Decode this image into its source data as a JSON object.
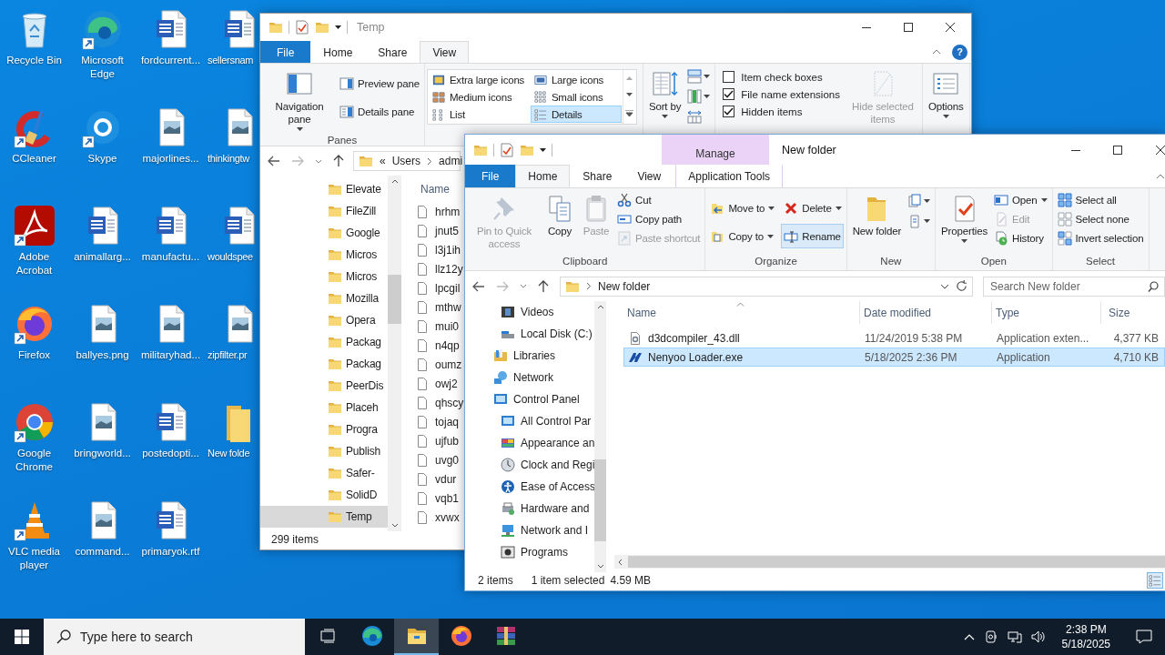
{
  "desktop": {
    "icons": [
      {
        "label": "Recycle Bin",
        "kind": "recycle-bin",
        "shortcut": false
      },
      {
        "label": "CCleaner",
        "kind": "ccleaner",
        "shortcut": true
      },
      {
        "label": "Adobe Acrobat",
        "kind": "acrobat",
        "shortcut": true
      },
      {
        "label": "Firefox",
        "kind": "firefox",
        "shortcut": true
      },
      {
        "label": "Google Chrome",
        "kind": "chrome",
        "shortcut": true
      },
      {
        "label": "VLC media player",
        "kind": "vlc",
        "shortcut": true
      },
      {
        "label": "Microsoft Edge",
        "kind": "edge",
        "shortcut": true
      },
      {
        "label": "Skype",
        "kind": "skype",
        "shortcut": true
      },
      {
        "label": "animallarg...",
        "kind": "word",
        "shortcut": false
      },
      {
        "label": "ballyes.png",
        "kind": "image",
        "shortcut": false
      },
      {
        "label": "bringworld...",
        "kind": "image",
        "shortcut": false
      },
      {
        "label": "command...",
        "kind": "image",
        "shortcut": false
      },
      {
        "label": "fordcurrent...",
        "kind": "word",
        "shortcut": false
      },
      {
        "label": "majorlines...",
        "kind": "image",
        "shortcut": false
      },
      {
        "label": "manufactu...",
        "kind": "word",
        "shortcut": false
      },
      {
        "label": "militaryhad...",
        "kind": "image",
        "shortcut": false
      },
      {
        "label": "postedopti...",
        "kind": "word",
        "shortcut": false
      },
      {
        "label": "primaryok.rtf",
        "kind": "word",
        "shortcut": false
      },
      {
        "label": "sellersnam",
        "kind": "word",
        "shortcut": false
      },
      {
        "label": "thinkingtw",
        "kind": "image",
        "shortcut": false
      },
      {
        "label": "wouldspee",
        "kind": "word",
        "shortcut": false
      },
      {
        "label": "zipfilter.pr",
        "kind": "image",
        "shortcut": false
      },
      {
        "label": "New folde",
        "kind": "folder",
        "shortcut": false
      }
    ]
  },
  "temp_window": {
    "title": "Temp",
    "tabs": [
      {
        "label": "File",
        "kind": "file",
        "selected": false
      },
      {
        "label": "Home",
        "kind": "tab",
        "selected": false
      },
      {
        "label": "Share",
        "kind": "tab",
        "selected": false
      },
      {
        "label": "View",
        "kind": "tab",
        "selected": true
      }
    ],
    "help": "?",
    "ribbon": [
      {
        "kind": "commands",
        "label": "Panes",
        "commands": [
          {
            "label": "Navigation pane",
            "kind": "large",
            "dropdown": true,
            "disabled": false,
            "highlighted": false
          },
          {
            "label": "Preview pane",
            "kind": "medium",
            "dropdown": false,
            "disabled": false,
            "highlighted": false
          },
          {
            "label": "Details pane",
            "kind": "medium",
            "dropdown": false,
            "disabled": false,
            "highlighted": false
          }
        ]
      },
      {
        "kind": "gallery",
        "items": [
          {
            "label": "Extra large icons",
            "selected": false
          },
          {
            "label": "Large icons",
            "selected": false
          },
          {
            "label": "Medium icons",
            "selected": false
          },
          {
            "label": "Small icons",
            "selected": false
          },
          {
            "label": "List",
            "selected": false
          },
          {
            "label": "Details",
            "selected": true
          }
        ]
      },
      {
        "kind": "commands",
        "commands": [
          {
            "label": "Sort by",
            "kind": "large",
            "dropdown": true,
            "disabled": false,
            "highlighted": false
          },
          {
            "kind": "icon",
            "dropdown": true,
            "disabled": false,
            "highlighted": false
          },
          {
            "kind": "icon",
            "dropdown": true,
            "disabled": false,
            "highlighted": false
          },
          {
            "kind": "icon",
            "dropdown": false,
            "disabled": false,
            "highlighted": false
          }
        ]
      },
      {
        "kind": "checks",
        "checks": [
          {
            "label": "Item check boxes",
            "checked": false
          },
          {
            "label": "File name extensions",
            "checked": true
          },
          {
            "label": "Hidden items",
            "checked": true
          }
        ],
        "commands": [
          {
            "label": "Hide selected items",
            "kind": "large",
            "dropdown": false,
            "disabled": true,
            "highlighted": false
          }
        ]
      },
      {
        "kind": "commands",
        "commands": [
          {
            "label": "Options",
            "kind": "large",
            "dropdown": true,
            "disabled": false,
            "highlighted": false
          }
        ]
      }
    ],
    "address": {
      "overflow": "«",
      "path": [
        "Users",
        "admi"
      ]
    },
    "nav": [
      {
        "label": "Elevate",
        "selected": false
      },
      {
        "label": "FileZill",
        "selected": false
      },
      {
        "label": "Google",
        "selected": false
      },
      {
        "label": "Micros",
        "selected": false
      },
      {
        "label": "Micros",
        "selected": false
      },
      {
        "label": "Mozilla",
        "selected": false
      },
      {
        "label": "Opera",
        "selected": false
      },
      {
        "label": "Packag",
        "selected": false
      },
      {
        "label": "Packag",
        "selected": false
      },
      {
        "label": "PeerDis",
        "selected": false
      },
      {
        "label": "Placeh",
        "selected": false
      },
      {
        "label": "Progra",
        "selected": false
      },
      {
        "label": "Publish",
        "selected": false
      },
      {
        "label": "Safer-",
        "selected": false
      },
      {
        "label": "SolidD",
        "selected": false
      },
      {
        "label": "Temp",
        "selected": true
      }
    ],
    "list_header": "Name",
    "files": [
      "hrhm",
      "jnut5",
      "l3j1ih",
      "llz12y",
      "lpcgil",
      "mthw",
      "mui0",
      "n4qp",
      "oumz",
      "owj2",
      "qhscy",
      "tojaq",
      "ujfub",
      "uvg0",
      "vdur",
      "vqb1",
      "xvwx"
    ],
    "status": "299 items"
  },
  "folder_window": {
    "title": "New folder",
    "context": {
      "header": "Manage",
      "label": "Application Tools",
      "selected": false
    },
    "tabs": [
      {
        "label": "File",
        "kind": "file",
        "selected": false
      },
      {
        "label": "Home",
        "kind": "tab",
        "selected": true
      },
      {
        "label": "Share",
        "kind": "tab",
        "selected": false
      },
      {
        "label": "View",
        "kind": "tab",
        "selected": false
      }
    ],
    "ribbon": [
      {
        "kind": "commands",
        "label": "Clipboard",
        "commands": [
          {
            "label": "Pin to Quick access",
            "kind": "large",
            "dropdown": false,
            "disabled": true,
            "highlighted": false
          },
          {
            "label": "Copy",
            "kind": "large",
            "dropdown": false,
            "disabled": false,
            "highlighted": false
          },
          {
            "label": "Paste",
            "kind": "large",
            "dropdown": false,
            "disabled": true,
            "highlighted": false
          },
          {
            "label": "Cut",
            "kind": "small",
            "dropdown": false,
            "disabled": false,
            "highlighted": false
          },
          {
            "label": "Copy path",
            "kind": "small",
            "dropdown": false,
            "disabled": false,
            "highlighted": false
          },
          {
            "label": "Paste shortcut",
            "kind": "small",
            "dropdown": false,
            "disabled": true,
            "highlighted": false
          }
        ]
      },
      {
        "kind": "commands",
        "label": "Organize",
        "commands": [
          {
            "label": "Move to",
            "kind": "medium",
            "dropdown": true,
            "disabled": false,
            "highlighted": false
          },
          {
            "label": "Copy to",
            "kind": "medium",
            "dropdown": true,
            "disabled": false,
            "highlighted": false
          },
          {
            "label": "Delete",
            "kind": "medium",
            "dropdown": true,
            "disabled": false,
            "highlighted": false
          },
          {
            "label": "Rename",
            "kind": "medium",
            "dropdown": false,
            "disabled": false,
            "highlighted": true
          }
        ]
      },
      {
        "kind": "commands",
        "label": "New",
        "commands": [
          {
            "label": "New folder",
            "kind": "large",
            "dropdown": false,
            "disabled": false,
            "highlighted": false
          },
          {
            "kind": "icon",
            "dropdown": true,
            "disabled": false,
            "highlighted": false
          },
          {
            "kind": "icon",
            "dropdown": true,
            "disabled": false,
            "highlighted": false
          }
        ]
      },
      {
        "kind": "commands",
        "label": "Open",
        "commands": [
          {
            "label": "Properties",
            "kind": "large",
            "dropdown": true,
            "disabled": false,
            "highlighted": false
          },
          {
            "label": "Open",
            "kind": "small",
            "dropdown": true,
            "disabled": false,
            "highlighted": false
          },
          {
            "label": "Edit",
            "kind": "small",
            "dropdown": false,
            "disabled": true,
            "highlighted": false
          },
          {
            "label": "History",
            "kind": "small",
            "dropdown": false,
            "disabled": false,
            "highlighted": false
          }
        ]
      },
      {
        "kind": "commands",
        "label": "Select",
        "commands": [
          {
            "label": "Select all",
            "kind": "small",
            "dropdown": false,
            "disabled": false,
            "highlighted": false
          },
          {
            "label": "Select none",
            "kind": "small",
            "dropdown": false,
            "disabled": false,
            "highlighted": false
          },
          {
            "label": "Invert selection",
            "kind": "small",
            "dropdown": false,
            "disabled": false,
            "highlighted": false
          }
        ]
      }
    ],
    "address": "New folder",
    "search": {
      "placeholder": "Search New folder"
    },
    "nav": {
      "continued": [
        {
          "label": "Videos",
          "kind": "videos"
        },
        {
          "label": "Local Disk (C:)",
          "kind": "disk"
        }
      ],
      "items": [
        {
          "label": "Libraries",
          "kind": "libraries"
        },
        {
          "label": "Network",
          "kind": "network"
        },
        {
          "label": "Control Panel",
          "kind": "control-panel",
          "children": [
            {
              "label": "All Control Par",
              "kind": "control-panel"
            },
            {
              "label": "Appearance an",
              "kind": "appearance"
            },
            {
              "label": "Clock and Regi",
              "kind": "clock"
            },
            {
              "label": "Ease of Access",
              "kind": "ease"
            },
            {
              "label": "Hardware and",
              "kind": "hardware"
            },
            {
              "label": "Network and I",
              "kind": "network-center"
            },
            {
              "label": "Programs",
              "kind": "programs"
            }
          ]
        }
      ]
    },
    "columns": [
      "Name",
      "Date modified",
      "Type",
      "Size"
    ],
    "rows": [
      {
        "name": "d3dcompiler_43.dll",
        "date": "11/24/2019 5:38 PM",
        "type": "Application exten...",
        "size": "4,377 KB",
        "kind": "dll",
        "selected": false
      },
      {
        "name": "Nenyoo Loader.exe",
        "date": "5/18/2025 2:36 PM",
        "type": "Application",
        "size": "4,710 KB",
        "kind": "exe",
        "selected": true
      }
    ],
    "status": {
      "count": "2 items",
      "selection": "1 item selected",
      "size": "4.59 MB"
    }
  },
  "taskbar": {
    "search": {
      "placeholder": "Type here to search"
    },
    "apps": [
      {
        "kind": "task-view",
        "active": false
      },
      {
        "kind": "edge",
        "active": false
      },
      {
        "kind": "explorer",
        "active": true
      },
      {
        "kind": "firefox",
        "active": false
      },
      {
        "kind": "winrar",
        "active": false
      }
    ],
    "time": "2:38 PM",
    "date": "5/18/2025"
  }
}
